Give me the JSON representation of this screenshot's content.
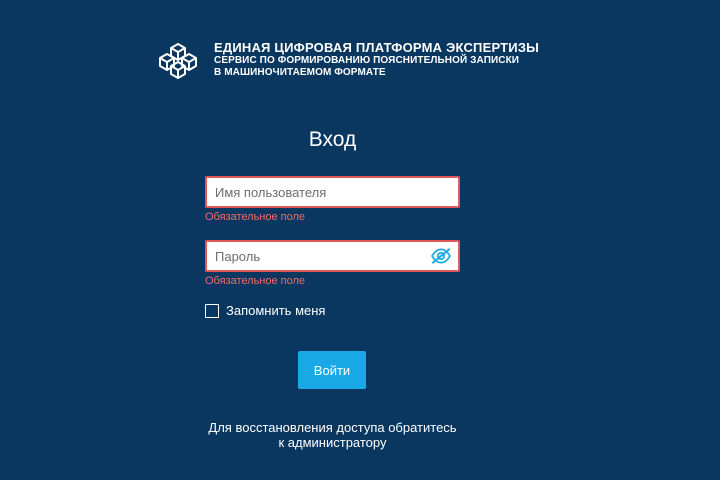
{
  "brand": {
    "title": "ЕДИНАЯ ЦИФРОВАЯ ПЛАТФОРМА ЭКСПЕРТИЗЫ",
    "subtitle_line1": "СЕРВИС ПО ФОРМИРОВАНИЮ ПОЯСНИТЕЛЬНОЙ ЗАПИСКИ",
    "subtitle_line2": "В МАШИНОЧИТАЕМОМ ФОРМАТЕ",
    "logo_icon": "cubes-logo-icon"
  },
  "login": {
    "title": "Вход",
    "username": {
      "value": "",
      "placeholder": "Имя пользователя",
      "error": "Обязательное поле"
    },
    "password": {
      "value": "",
      "placeholder": "Пароль",
      "error": "Обязательное поле",
      "toggle_icon": "eye-slash-icon"
    },
    "remember": {
      "label": "Запомнить меня",
      "checked": false
    },
    "submit_label": "Войти",
    "help_line1": "Для восстановления доступа обратитесь",
    "help_line2": "к администратору"
  },
  "colors": {
    "background": "#0a3760",
    "accent": "#1aa9e6",
    "error": "#f26a6a",
    "field_border_error": "#e05a5a"
  }
}
